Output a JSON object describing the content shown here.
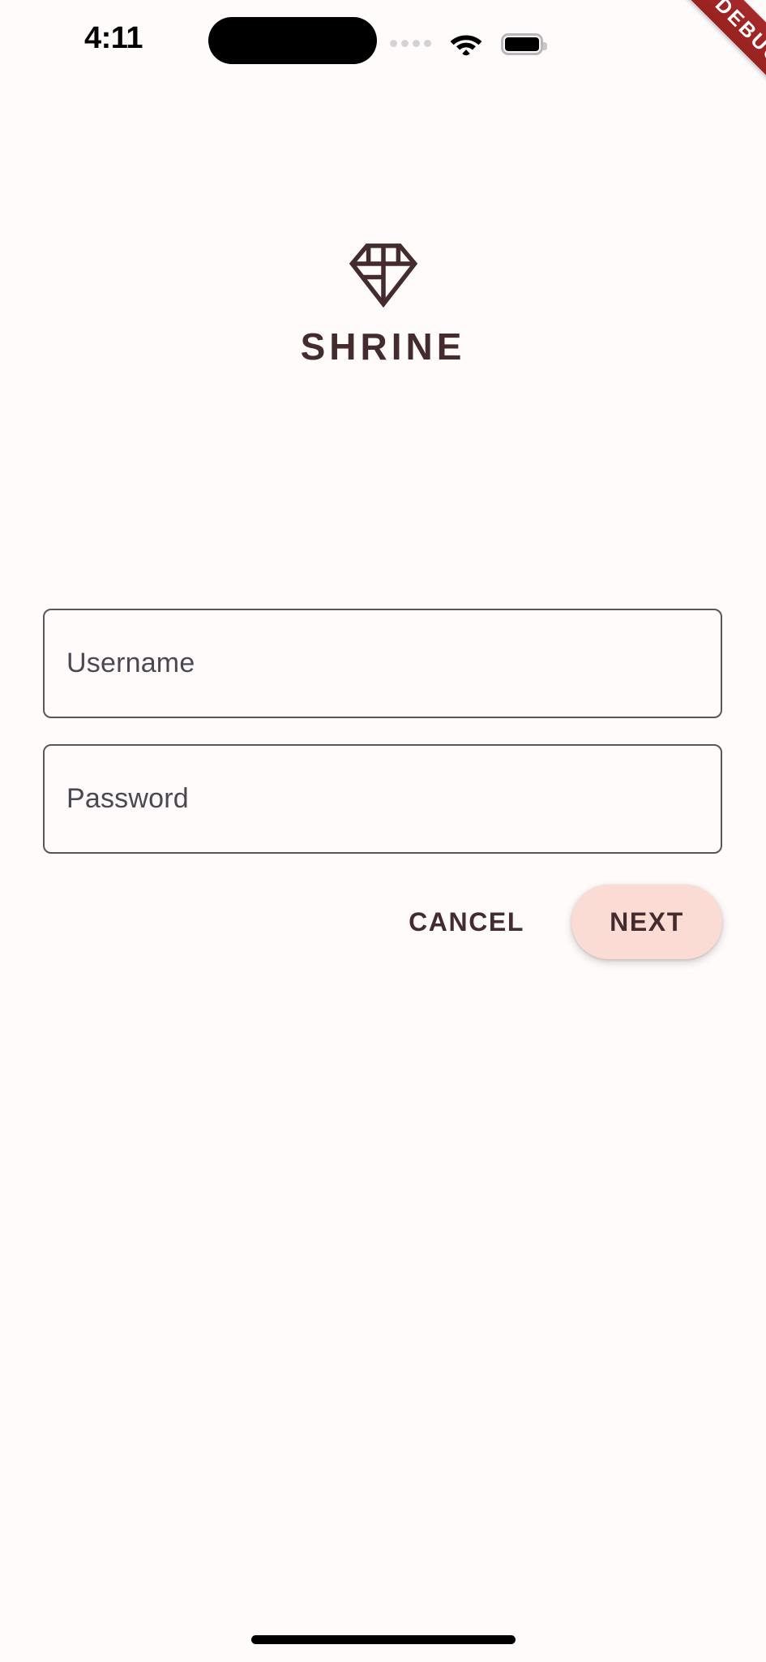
{
  "app": {
    "name": "SHRINE",
    "background_color": "#FFFBFB",
    "brand_color": "#442C2E",
    "accent_color": "#FADCD5"
  },
  "status_bar": {
    "time": "4:11",
    "signal_icon": "signal-dots-icon",
    "wifi_icon": "wifi-icon",
    "battery_icon": "battery-icon"
  },
  "debug_banner": {
    "label": "DEBUG",
    "color": "#9E2020",
    "text_color": "#FFFFFF"
  },
  "brand": {
    "logo_icon": "diamond-logo-icon",
    "title": "SHRINE"
  },
  "form": {
    "fields": [
      {
        "name": "username",
        "label": "Username",
        "value": "",
        "placeholder": "Username"
      },
      {
        "name": "password",
        "label": "Password",
        "value": "",
        "placeholder": "Password"
      }
    ]
  },
  "actions": {
    "cancel_label": "CANCEL",
    "next_label": "NEXT"
  },
  "system": {
    "home_indicator": "home-indicator"
  }
}
